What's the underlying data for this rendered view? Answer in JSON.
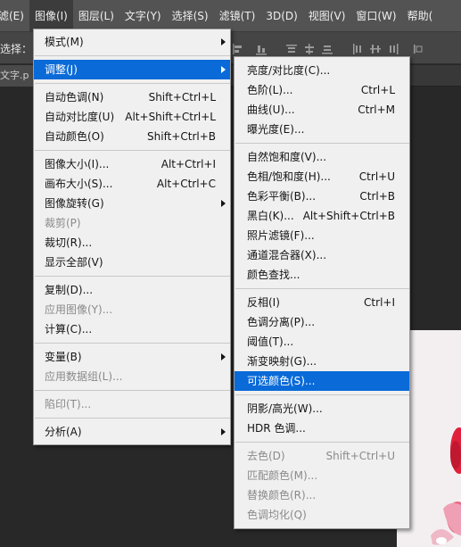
{
  "menubar": {
    "items": [
      "滤(E)",
      "图像(I)",
      "图层(L)",
      "文字(Y)",
      "选择(S)",
      "滤镜(T)",
      "3D(D)",
      "视图(V)",
      "窗口(W)",
      "帮助("
    ]
  },
  "options_bar": {
    "label": "选择："
  },
  "doc_tab": {
    "label": "文字.p"
  },
  "image_menu": {
    "items": [
      {
        "label": "模式(M)",
        "submenu": true
      },
      {
        "sep": true
      },
      {
        "label": "调整(J)",
        "submenu": true,
        "highlight": true
      },
      {
        "sep": true
      },
      {
        "label": "自动色调(N)",
        "shortcut": "Shift+Ctrl+L"
      },
      {
        "label": "自动对比度(U)",
        "shortcut": "Alt+Shift+Ctrl+L"
      },
      {
        "label": "自动颜色(O)",
        "shortcut": "Shift+Ctrl+B"
      },
      {
        "sep": true
      },
      {
        "label": "图像大小(I)...",
        "shortcut": "Alt+Ctrl+I"
      },
      {
        "label": "画布大小(S)...",
        "shortcut": "Alt+Ctrl+C"
      },
      {
        "label": "图像旋转(G)",
        "submenu": true
      },
      {
        "label": "裁剪(P)",
        "disabled": true
      },
      {
        "label": "裁切(R)..."
      },
      {
        "label": "显示全部(V)"
      },
      {
        "sep": true
      },
      {
        "label": "复制(D)..."
      },
      {
        "label": "应用图像(Y)...",
        "disabled": true
      },
      {
        "label": "计算(C)..."
      },
      {
        "sep": true
      },
      {
        "label": "变量(B)",
        "submenu": true
      },
      {
        "label": "应用数据组(L)...",
        "disabled": true
      },
      {
        "sep": true
      },
      {
        "label": "陷印(T)...",
        "disabled": true
      },
      {
        "sep": true
      },
      {
        "label": "分析(A)",
        "submenu": true
      }
    ]
  },
  "adjust_menu": {
    "items": [
      {
        "label": "亮度/对比度(C)..."
      },
      {
        "label": "色阶(L)...",
        "shortcut": "Ctrl+L"
      },
      {
        "label": "曲线(U)...",
        "shortcut": "Ctrl+M"
      },
      {
        "label": "曝光度(E)..."
      },
      {
        "sep": true
      },
      {
        "label": "自然饱和度(V)..."
      },
      {
        "label": "色相/饱和度(H)...",
        "shortcut": "Ctrl+U"
      },
      {
        "label": "色彩平衡(B)...",
        "shortcut": "Ctrl+B"
      },
      {
        "label": "黑白(K)...",
        "shortcut": "Alt+Shift+Ctrl+B"
      },
      {
        "label": "照片滤镜(F)..."
      },
      {
        "label": "通道混合器(X)..."
      },
      {
        "label": "颜色查找..."
      },
      {
        "sep": true
      },
      {
        "label": "反相(I)",
        "shortcut": "Ctrl+I"
      },
      {
        "label": "色调分离(P)..."
      },
      {
        "label": "阈值(T)..."
      },
      {
        "label": "渐变映射(G)..."
      },
      {
        "label": "可选颜色(S)...",
        "highlight": true
      },
      {
        "sep": true
      },
      {
        "label": "阴影/高光(W)..."
      },
      {
        "label": "HDR 色调..."
      },
      {
        "sep": true
      },
      {
        "label": "去色(D)",
        "shortcut": "Shift+Ctrl+U",
        "disabled": true
      },
      {
        "label": "匹配颜色(M)...",
        "disabled": true
      },
      {
        "label": "替换颜色(R)...",
        "disabled": true
      },
      {
        "label": "色调均化(Q)",
        "disabled": true
      }
    ]
  },
  "colors": {
    "menu_bg": "#f0f0f0",
    "highlight": "#0a6ad8",
    "menubar_bg": "#535353",
    "workspace_bg": "#282828"
  }
}
